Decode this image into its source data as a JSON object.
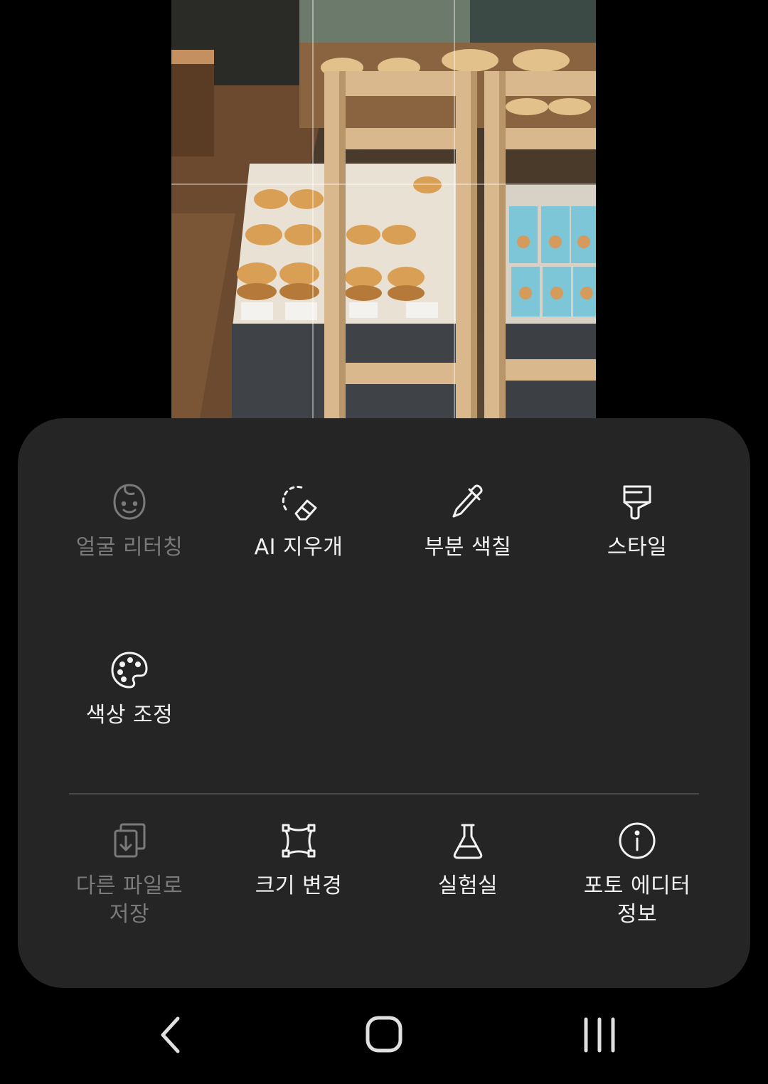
{
  "photo": {
    "subject": "bakery"
  },
  "tools": {
    "primary": [
      {
        "label": "얼굴 리터칭",
        "icon": "face-icon",
        "enabled": false
      },
      {
        "label": "AI 지우개",
        "icon": "ai-eraser-icon",
        "enabled": true
      },
      {
        "label": "부분 색칠",
        "icon": "color-picker-icon",
        "enabled": true
      },
      {
        "label": "스타일",
        "icon": "paint-brush-icon",
        "enabled": true
      },
      {
        "label": "색상 조정",
        "icon": "palette-icon",
        "enabled": true
      }
    ],
    "secondary": [
      {
        "label": "다른 파일로\n저장",
        "icon": "save-as-icon",
        "enabled": false
      },
      {
        "label": "크기 변경",
        "icon": "resize-icon",
        "enabled": true
      },
      {
        "label": "실험실",
        "icon": "flask-icon",
        "enabled": true
      },
      {
        "label": "포토 에디터\n정보",
        "icon": "info-icon",
        "enabled": true
      }
    ]
  },
  "navbar": {
    "back": "chevron-left-icon",
    "home": "home-icon",
    "recents": "recents-icon"
  },
  "colors": {
    "sheet": "#252525",
    "text": "#f2f2f2",
    "disabled": "#7a7a7a"
  }
}
